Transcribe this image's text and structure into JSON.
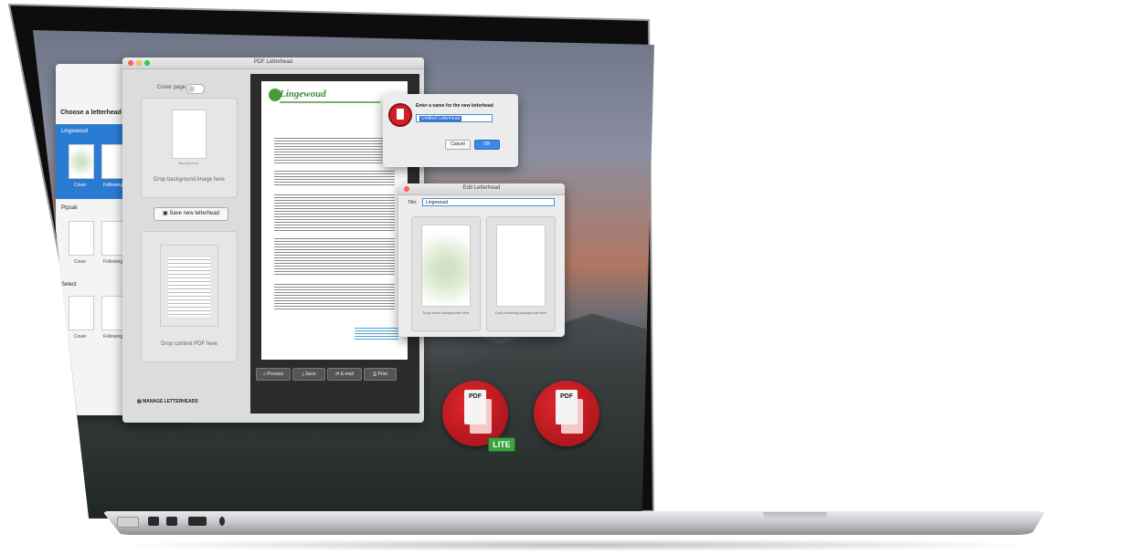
{
  "chooser": {
    "title": "Choose a letterhead",
    "letterheads": [
      {
        "name": "Lingewoud",
        "cover_label": "Cover",
        "following_label": "Following"
      },
      {
        "name": "Pipsali",
        "cover_label": "Cover",
        "following_label": "Following"
      },
      {
        "name": "Select",
        "cover_label": "Cover",
        "following_label": "Following"
      }
    ],
    "add_button": "+ ▾"
  },
  "main_window": {
    "title": "PDF Letterhead",
    "cover_page_label": "Cover page",
    "background_caption": "Background",
    "drop_background": "Drop background image here",
    "save_new": "Save new letterhead",
    "drop_content": "Drop content PDF here",
    "manage": "MANAGE LETTERHEADS",
    "company": "Lingewoud",
    "toolbar": {
      "preview": "Preview",
      "save": "Save",
      "email": "E-mail",
      "print": "Print"
    }
  },
  "dialog": {
    "prompt": "Enter a name for the new letterhead",
    "input_value": "Untitled Letterhead",
    "cancel": "Cancel",
    "ok": "OK"
  },
  "edit_window": {
    "title": "Edit Letterhead",
    "title_label": "Title:",
    "title_value": "Lingewoud",
    "drop_cover": "Drop cover background here",
    "drop_following": "Drop following background here"
  },
  "app_icons": {
    "lite_label": "PDF",
    "lite_badge": "LITE",
    "full_label": "PDF"
  },
  "colors": {
    "accent_blue": "#2a7cd3",
    "brand_red": "#d32027",
    "lite_green": "#3aa241",
    "company_green": "#3a8a3a"
  }
}
